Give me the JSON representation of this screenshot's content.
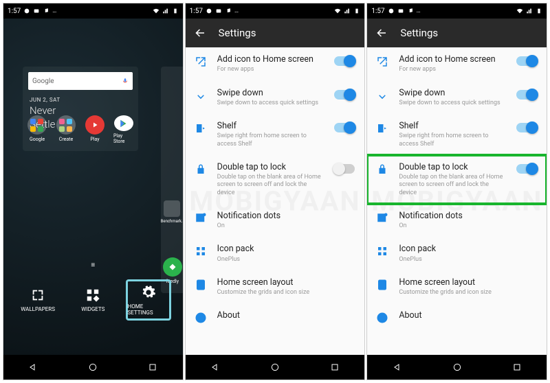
{
  "status": {
    "time": "1:57"
  },
  "home": {
    "search_label": "Google",
    "date": "JUN 2, SAT",
    "tagline_1": "Never",
    "tagline_2": "Settle",
    "side_label": "Benchmark...",
    "apps": {
      "google": "Google",
      "create": "Create",
      "play": "Play",
      "playstore": "Play Store",
      "feedly": "feedly"
    },
    "bottom": {
      "wallpapers": "WALLPAPERS",
      "widgets": "WIDGETS",
      "home_settings": "HOME SETTINGS"
    }
  },
  "settings": {
    "title": "Settings",
    "rows": {
      "add_icon": {
        "title": "Add icon to Home screen",
        "sub": "For new apps"
      },
      "swipe_down": {
        "title": "Swipe down",
        "sub": "Swipe down to access quick settings"
      },
      "shelf": {
        "title": "Shelf",
        "sub": "Swipe right from home screen to access Shelf"
      },
      "double_tap": {
        "title": "Double tap to lock",
        "sub": "Double tap on the blank area of Home screen to screen off and lock the device"
      },
      "notif_dots": {
        "title": "Notification dots",
        "sub": "On"
      },
      "icon_pack": {
        "title": "Icon pack",
        "sub": "OnePlus"
      },
      "layout": {
        "title": "Home screen layout",
        "sub": "Customize the grids and icon size"
      },
      "about": {
        "title": "About"
      }
    }
  },
  "watermark": "MOBIGYAAN"
}
